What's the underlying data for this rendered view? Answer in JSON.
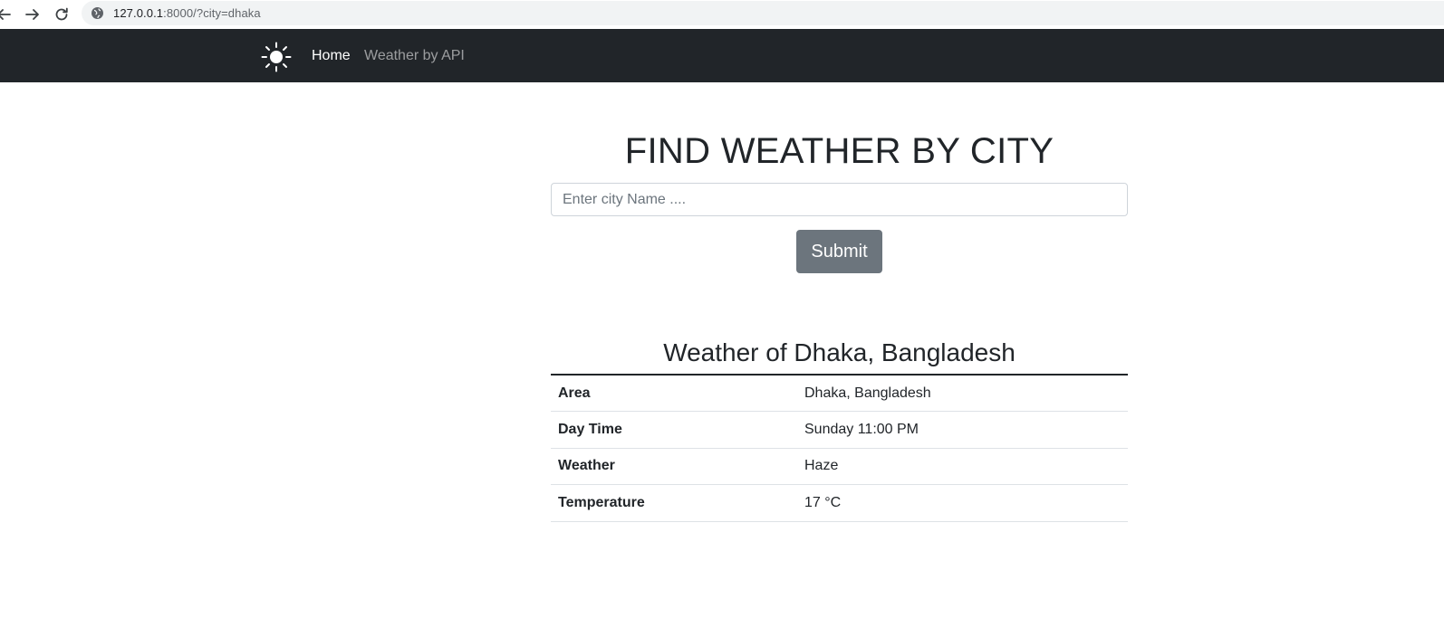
{
  "browser": {
    "url_host": "127.0.0.1",
    "url_rest": ":8000/?city=dhaka"
  },
  "navbar": {
    "brand_icon": "sun-icon",
    "links": [
      {
        "label": "Home",
        "active": true
      },
      {
        "label": "Weather by API",
        "active": false
      }
    ]
  },
  "main": {
    "title": "FIND WEATHER BY CITY",
    "search": {
      "placeholder": "Enter city Name ....",
      "value": ""
    },
    "submit_label": "Submit",
    "result": {
      "title": "Weather of Dhaka, Bangladesh",
      "rows": [
        {
          "label": "Area",
          "value": "Dhaka, Bangladesh"
        },
        {
          "label": "Day Time",
          "value": "Sunday 11:00 PM"
        },
        {
          "label": "Weather",
          "value": "Haze"
        },
        {
          "label": "Temperature",
          "value": "17 °C"
        }
      ]
    }
  },
  "colors": {
    "navbar_bg": "#212529",
    "button_bg": "#6c757d",
    "text": "#212529"
  }
}
